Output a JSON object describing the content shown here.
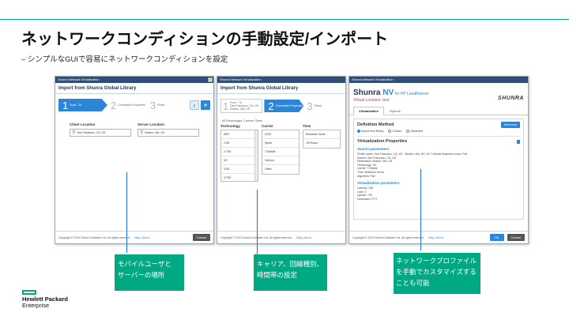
{
  "slide": {
    "title": "ネットワークコンディションの手動設定/インポート",
    "subtitle": "– シンプルなGUIで容易にネットワークコンディションを設定"
  },
  "window1": {
    "titlebar": "Shunra Network Virtualization",
    "heading": "Import from Shunra Global Library",
    "steps": [
      {
        "num": "1",
        "label": "From - To"
      },
      {
        "num": "2",
        "label": "Connection Properties"
      },
      {
        "num": "3",
        "label": "Finish"
      }
    ],
    "nav_prev": "‹",
    "nav_next": "»",
    "client_label": "Client Location",
    "client_value": "San Francisco, CA, US",
    "server_label": "Server Location",
    "server_value": "Boston, MA, US",
    "footer_copy": "Copyright © 2013 Shunra Software Ltd. All rights reserved",
    "footer_links": "Help | About",
    "cancel": "Cancel"
  },
  "window2": {
    "titlebar": "Shunra Network Virtualization",
    "heading": "Import from Shunra Global Library",
    "step1_label1": "From - To",
    "step1_label2": "San Francisco, CA, US -",
    "step1_label3": "Boston, MA, US",
    "step2_label": "Connection Properties",
    "step3_label": "Finish",
    "filter": "All Technologies; Carriers; Times",
    "tech_head": "Technology",
    "carrier_head": "Carrier",
    "time_head": "Time",
    "technologies": [
      "WiFi",
      "2.5G",
      "2.75G",
      "3G",
      "3.5G",
      "3.75G"
    ],
    "carriers": [
      "AT&T",
      "Sprint",
      "T-Mobile",
      "Verizon",
      "Other"
    ],
    "times": [
      "Business Hours",
      "Off Hours"
    ],
    "footer_copy": "Copyright © 2013 Shunra Software Ltd. All rights reserved",
    "footer_links": "Help | About"
  },
  "window3": {
    "titlebar": "Shunra Network Virtualization",
    "brand": "Shunra ",
    "brand_nv": "NV",
    "brand_for": " for HP LoadRunner",
    "virtual_location": "Virtual Location: test",
    "logo": "SHUNRA",
    "tab_virtualization": "Virtualization",
    "tab_options": "Options",
    "definition_method": "Definition Method",
    "summary": "Summary",
    "radio_import": "Import from library",
    "radio_custom": "Custom",
    "radio_advanced": "Advanced",
    "virt_props": "Virtualization Properties",
    "search_params": "Search parameters",
    "search_lines": [
      "Profile name: San Francisco, CA, US - Boston, MA, US, 3G T-Mobile Business hours, Fair",
      "Source: San Francisco, CA, US",
      "Destination: Boston, MA, US",
      "Technology: 3G",
      "Carrier: T-Mobile",
      "Time: Business Hours",
      "Algorithm: Fair"
    ],
    "virt_params": "Virtualization parameters",
    "param_lines": [
      "Latency: 238",
      "Loss: 0",
      "Upload: 733",
      "Download: 2777"
    ],
    "footer_copy": "Copyright © 2013 Shunra Software Ltd. All rights reserved",
    "footer_links": "Help | About",
    "ok": "OK",
    "cancel": "Cancel"
  },
  "callouts": {
    "c1_line1": "モバイルユーザと",
    "c1_line2": "サーバーの場所",
    "c2_line1": "キャリア、回線種別、",
    "c2_line2": "時間帯の設定",
    "c3_line1": "ネットワークプロファイル",
    "c3_line2": "を手動でカスタマイズする",
    "c3_line3": "ことも可能"
  },
  "footer_logo": {
    "line1": "Hewlett Packard",
    "line2": "Enterprise"
  },
  "colors": {
    "accent": "#01a982",
    "ui_blue": "#2c86d8",
    "callout_line": "#1e6fd9",
    "titlebar": "#2f4f7a"
  }
}
